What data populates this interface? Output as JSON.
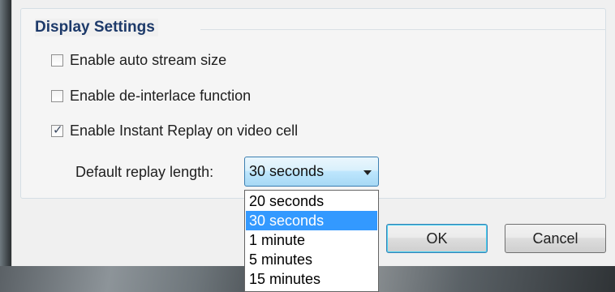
{
  "display_settings": {
    "title": "Display Settings",
    "options": [
      {
        "label": "Enable auto stream size",
        "checked": false
      },
      {
        "label": "Enable de-interlace function",
        "checked": false
      },
      {
        "label": "Enable Instant Replay on video cell",
        "checked": true
      }
    ],
    "replay_length_label": "Default replay length:",
    "replay_length_value": "30 seconds",
    "replay_length_options": [
      "20 seconds",
      "30 seconds",
      "1 minute",
      "5 minutes",
      "15 minutes"
    ]
  },
  "buttons": {
    "ok": "OK",
    "cancel": "Cancel"
  },
  "colors": {
    "title": "#1d3a6a",
    "selection": "#3399ff",
    "focus_border": "#3c7fb1"
  }
}
